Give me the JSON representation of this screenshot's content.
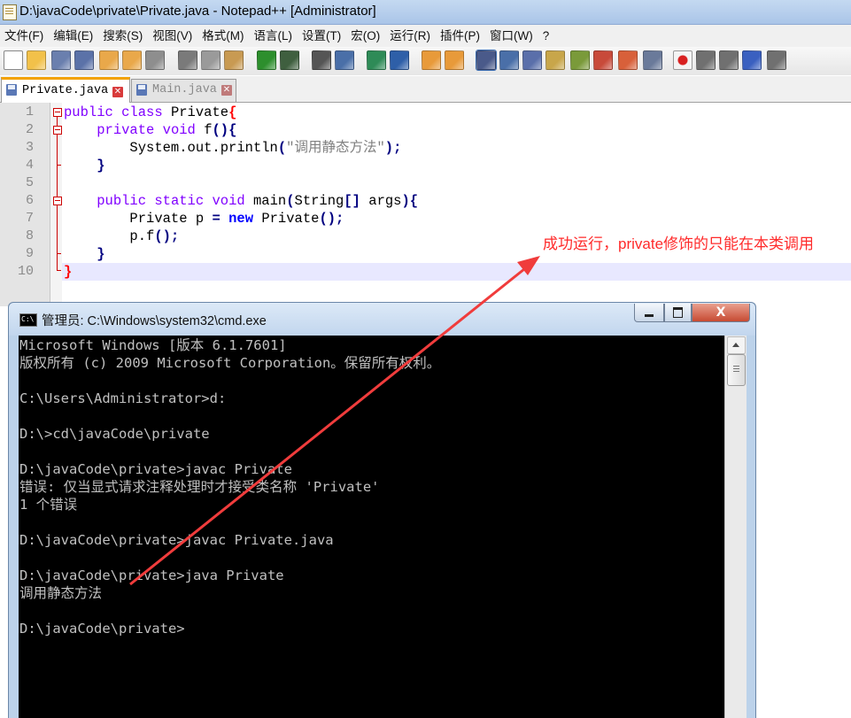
{
  "notepad": {
    "title": "D:\\javaCode\\private\\Private.java - Notepad++ [Administrator]",
    "menu": [
      "文件(F)",
      "编辑(E)",
      "搜索(S)",
      "视图(V)",
      "格式(M)",
      "语言(L)",
      "设置(T)",
      "宏(O)",
      "运行(R)",
      "插件(P)",
      "窗口(W)",
      "?"
    ],
    "tabs": [
      {
        "label": "Private.java",
        "active": true
      },
      {
        "label": "Main.java",
        "active": false
      }
    ],
    "toolbar_icons": [
      "new-file-icon",
      "open-file-icon",
      "save-icon",
      "save-all-icon",
      "close-icon",
      "close-all-icon",
      "print-icon",
      "cut-icon",
      "copy-icon",
      "paste-icon",
      "undo-icon",
      "redo-icon",
      "find-icon",
      "replace-icon",
      "zoom-in-icon",
      "zoom-out-icon",
      "sync-vertical-icon",
      "sync-horizontal-icon",
      "word-wrap-icon",
      "show-all-characters-icon",
      "indent-guide-icon",
      "user-language-icon",
      "doc-map-icon",
      "function-list-icon",
      "folder-workspace-icon",
      "monitoring-icon",
      "record-macro-icon",
      "stop-record-icon",
      "playback-macro-icon",
      "run-macro-multiple-icon",
      "save-macro-icon"
    ]
  },
  "editor": {
    "line_numbers": [
      "1",
      "2",
      "3",
      "4",
      "5",
      "6",
      "7",
      "8",
      "9",
      "10"
    ],
    "lines": [
      "public class Private{",
      "    private void f(){",
      "        System.out.println(\"调用静态方法\");",
      "    }",
      "",
      "    public static void main(String[] args){",
      "        Private p = new Private();",
      "        p.f();",
      "    }",
      "}"
    ],
    "current_line": 10
  },
  "annotation": {
    "text": "成功运行，private修饰的只能在本类调用",
    "color": "#ff2a2a"
  },
  "cmd": {
    "title": "管理员: C:\\Windows\\system32\\cmd.exe",
    "icon_text": "C:\\",
    "close_label": "X",
    "lines": [
      "Microsoft Windows [版本 6.1.7601]",
      "版权所有 (c) 2009 Microsoft Corporation。保留所有权利。",
      "",
      "C:\\Users\\Administrator>d:",
      "",
      "D:\\>cd\\javaCode\\private",
      "",
      "D:\\javaCode\\private>javac Private",
      "错误: 仅当显式请求注释处理时才接受类名称 'Private'",
      "1 个错误",
      "",
      "D:\\javaCode\\private>javac Private.java",
      "",
      "D:\\javaCode\\private>java Private",
      "调用静态方法",
      "",
      "D:\\javaCode\\private>"
    ]
  },
  "colors": {
    "keyword": "#8000ff",
    "instr_keyword": "#0000ff",
    "brace_highlight": "#ff0000",
    "string": "#808080",
    "console_bg": "#000000",
    "console_fg": "#c0c0c0"
  }
}
